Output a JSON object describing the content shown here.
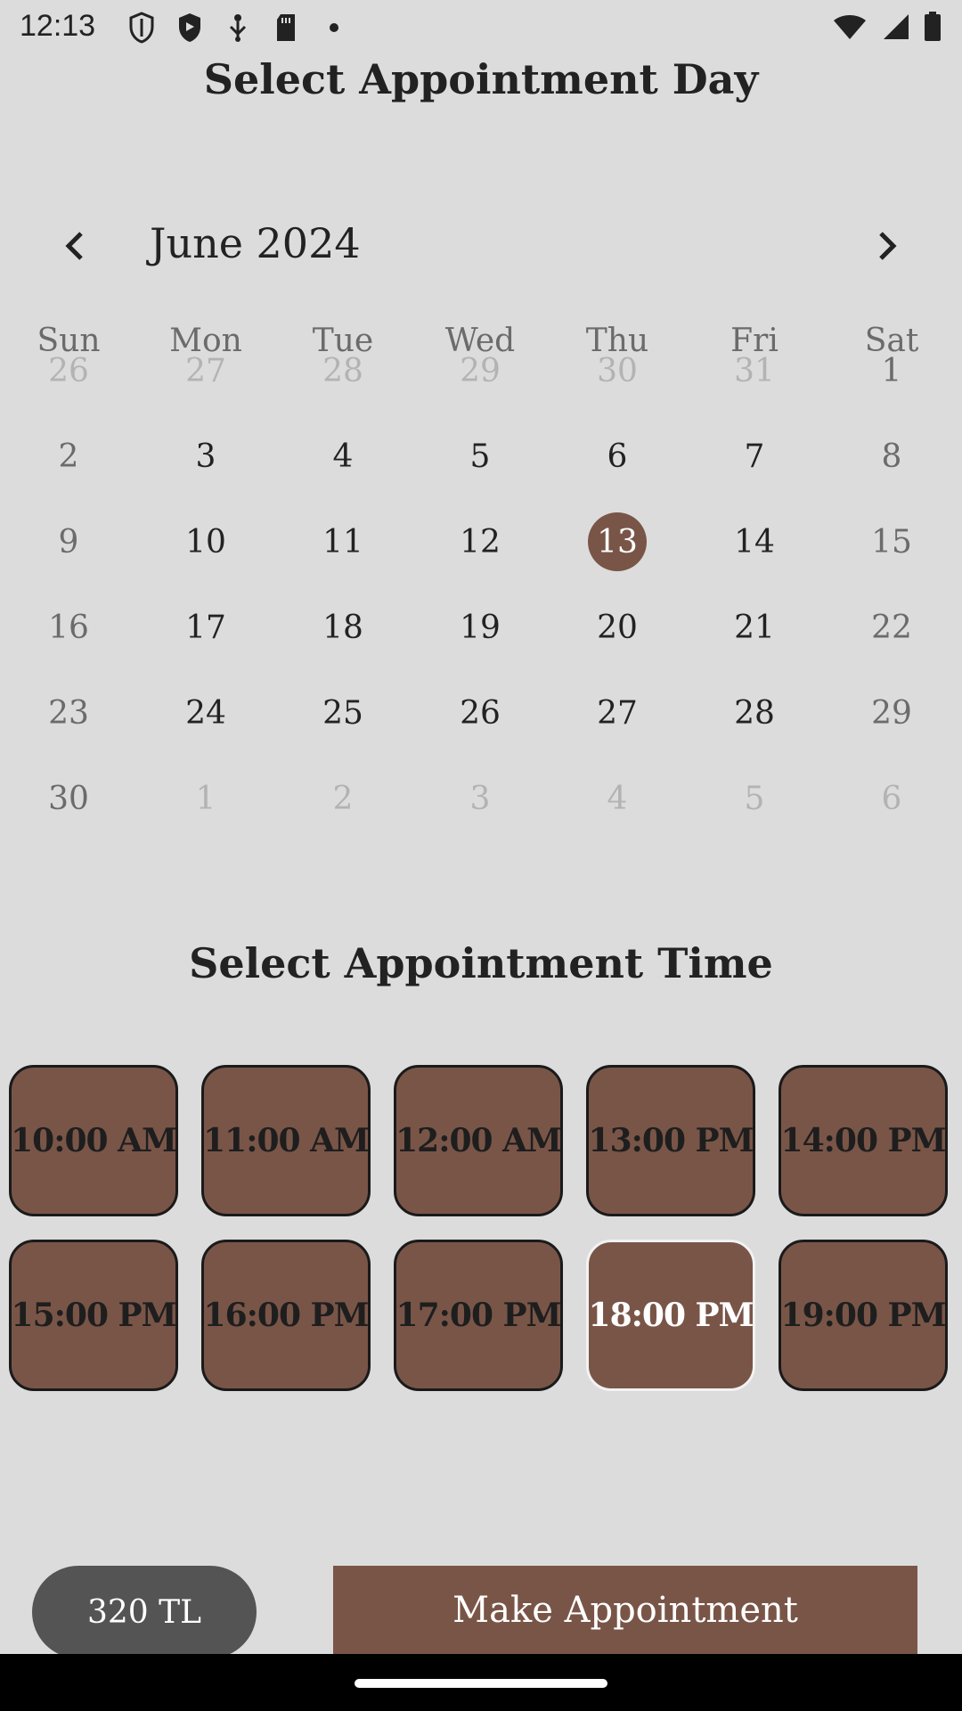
{
  "status_bar": {
    "time": "12:13",
    "left_icons": [
      "shield-outline-icon",
      "shield-filled-icon",
      "usb-icon",
      "sd-card-icon",
      "dot-icon"
    ],
    "right_icons": [
      "wifi-icon",
      "signal-icon",
      "battery-icon"
    ]
  },
  "day_heading": "Select Appointment Day",
  "calendar": {
    "month_label": "June 2024",
    "weekdays": [
      "Sun",
      "Mon",
      "Tue",
      "Wed",
      "Thu",
      "Fri",
      "Sat"
    ],
    "weeks": [
      [
        "26",
        "27",
        "28",
        "29",
        "30",
        "31",
        "1"
      ],
      [
        "2",
        "3",
        "4",
        "5",
        "6",
        "7",
        "8"
      ],
      [
        "9",
        "10",
        "11",
        "12",
        "13",
        "14",
        "15"
      ],
      [
        "16",
        "17",
        "18",
        "19",
        "20",
        "21",
        "22"
      ],
      [
        "23",
        "24",
        "25",
        "26",
        "27",
        "28",
        "29"
      ],
      [
        "30",
        "1",
        "2",
        "3",
        "4",
        "5",
        "6"
      ]
    ],
    "selected_day": "13"
  },
  "time_heading": "Select Appointment Time",
  "time_slots": [
    [
      "10:00 AM",
      "11:00 AM",
      "12:00 AM",
      "13:00 PM",
      "14:00 PM"
    ],
    [
      "15:00 PM",
      "16:00 PM",
      "17:00 PM",
      "18:00 PM",
      "19:00 PM"
    ]
  ],
  "selected_time": "18:00 PM",
  "footer": {
    "price": "320 TL",
    "make_appointment_label": "Make Appointment"
  },
  "colors": {
    "accent": "#795548",
    "background": "#dcdcdc",
    "price_pill": "#545454"
  }
}
